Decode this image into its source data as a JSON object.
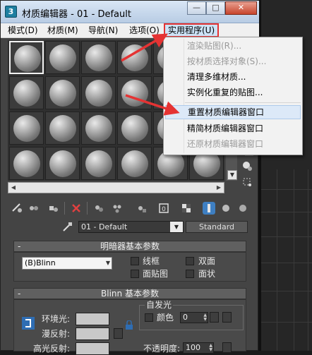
{
  "window": {
    "title": "材质编辑器 - 01 - Default",
    "icon_label": "3",
    "buttons": {
      "minimize": "—",
      "maximize": "□",
      "close": "✕"
    }
  },
  "menubar": {
    "items": [
      {
        "label": "模式(D)"
      },
      {
        "label": "材质(M)"
      },
      {
        "label": "导航(N)"
      },
      {
        "label": "选项(O)"
      },
      {
        "label": "实用程序(U)"
      }
    ]
  },
  "utility_menu": {
    "items": [
      {
        "label": "渲染贴图(R)...",
        "enabled": false
      },
      {
        "label": "按材质选择对象(S)...",
        "enabled": false
      },
      {
        "label": "清理多维材质...",
        "enabled": true
      },
      {
        "label": "实例化重复的贴图...",
        "enabled": true
      },
      {
        "label": "重置材质编辑器窗口",
        "enabled": true,
        "highlighted": true
      },
      {
        "label": "精简材质编辑器窗口",
        "enabled": true
      },
      {
        "label": "还原材质编辑器窗口",
        "enabled": false
      }
    ]
  },
  "slots": {
    "rows": 4,
    "cols": 6,
    "active_index": 0
  },
  "material": {
    "name": "01 - Default",
    "type_button": "Standard"
  },
  "shader_basic": {
    "title": "明暗器基本参数",
    "collapse": "-",
    "shader": "(B)Blinn",
    "options": [
      {
        "label": "线框"
      },
      {
        "label": "双面"
      },
      {
        "label": "面贴图"
      },
      {
        "label": "面状"
      }
    ]
  },
  "blinn_basic": {
    "title": "Blinn 基本参数",
    "collapse": "-",
    "ambient_label": "环境光:",
    "diffuse_label": "漫反射:",
    "specular_label": "高光反射:",
    "self_illum_group": "自发光",
    "color_label": "颜色",
    "self_illum_value": "0",
    "opacity_label": "不透明度:",
    "opacity_value": "100"
  },
  "colors": {
    "annotation": "#e53333",
    "menu_highlight": "#dce9f8"
  }
}
